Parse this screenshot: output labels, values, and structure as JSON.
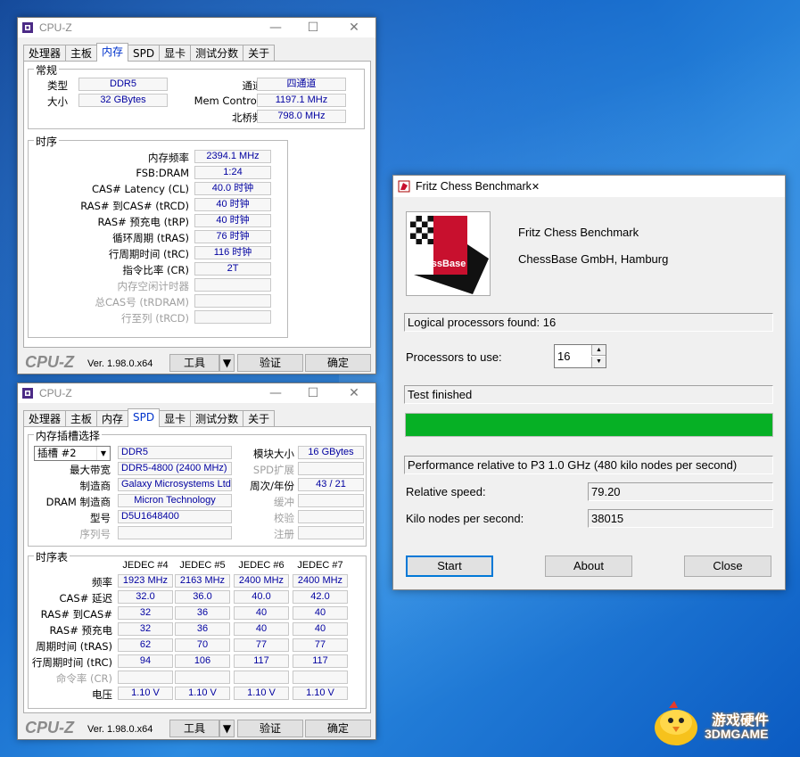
{
  "cpuz_common": {
    "title": "CPU-Z",
    "logo": "CPU-Z",
    "version": "Ver. 1.98.0.x64",
    "tools": "工具",
    "validate": "验证",
    "ok": "确定",
    "tabs": [
      "处理器",
      "主板",
      "内存",
      "SPD",
      "显卡",
      "测试分数",
      "关于"
    ]
  },
  "mem": {
    "general_title": "常规",
    "type_label": "类型",
    "type": "DDR5",
    "size_label": "大小",
    "size": "32 GBytes",
    "channels_label": "通道数",
    "channels": "四通道",
    "mc_label": "Mem Controller",
    "mc": "1197.1 MHz",
    "nb_label": "北桥频率",
    "nb": "798.0 MHz",
    "timing_title": "时序",
    "rows": [
      {
        "label": "内存频率",
        "value": "2394.1 MHz",
        "dim": false
      },
      {
        "label": "FSB:DRAM",
        "value": "1:24",
        "dim": false
      },
      {
        "label": "CAS# Latency (CL)",
        "value": "40.0 时钟",
        "dim": false
      },
      {
        "label": "RAS# 到CAS# (tRCD)",
        "value": "40 时钟",
        "dim": false
      },
      {
        "label": "RAS# 预充电 (tRP)",
        "value": "40 时钟",
        "dim": false
      },
      {
        "label": "循环周期 (tRAS)",
        "value": "76 时钟",
        "dim": false
      },
      {
        "label": "行周期时间 (tRC)",
        "value": "116 时钟",
        "dim": false
      },
      {
        "label": "指令比率 (CR)",
        "value": "2T",
        "dim": false
      },
      {
        "label": "内存空闲计时器",
        "value": "",
        "dim": true
      },
      {
        "label": "总CAS号 (tRDRAM)",
        "value": "",
        "dim": true
      },
      {
        "label": "行至列 (tRCD)",
        "value": "",
        "dim": true
      }
    ]
  },
  "spd": {
    "slot_title": "内存插槽选择",
    "slot": "插槽 #2",
    "type": "DDR5",
    "module_size_label": "模块大小",
    "module_size": "16 GBytes",
    "max_bw_label": "最大带宽",
    "max_bw": "DDR5-4800 (2400 MHz)",
    "spd_ext_label": "SPD扩展",
    "spd_ext": "",
    "mfr_label": "制造商",
    "mfr": "Galaxy Microsystems Ltd.",
    "week_label": "周次/年份",
    "week": "43 / 21",
    "dram_mfr_label": "DRAM 制造商",
    "dram_mfr": "Micron Technology",
    "buffer_label": "缓冲",
    "buffer": "",
    "part_label": "型号",
    "part": "D5U1648400",
    "check_label": "校验",
    "check": "",
    "serial_label": "序列号",
    "serial": "",
    "reg_label": "注册",
    "reg": "",
    "table_title": "时序表",
    "columns": [
      "JEDEC #4",
      "JEDEC #5",
      "JEDEC #6",
      "JEDEC #7"
    ],
    "rows": [
      {
        "label": "频率",
        "values": [
          "1923 MHz",
          "2163 MHz",
          "2400 MHz",
          "2400 MHz"
        ],
        "dim": false
      },
      {
        "label": "CAS# 延迟",
        "values": [
          "32.0",
          "36.0",
          "40.0",
          "42.0"
        ],
        "dim": false
      },
      {
        "label": "RAS# 到CAS#",
        "values": [
          "32",
          "36",
          "40",
          "40"
        ],
        "dim": false
      },
      {
        "label": "RAS# 预充电",
        "values": [
          "32",
          "36",
          "40",
          "40"
        ],
        "dim": false
      },
      {
        "label": "周期时间 (tRAS)",
        "values": [
          "62",
          "70",
          "77",
          "77"
        ],
        "dim": false
      },
      {
        "label": "行周期时间 (tRC)",
        "values": [
          "94",
          "106",
          "117",
          "117"
        ],
        "dim": false
      },
      {
        "label": "命令率 (CR)",
        "values": [
          "",
          "",
          "",
          ""
        ],
        "dim": true
      },
      {
        "label": "电压",
        "values": [
          "1.10 V",
          "1.10 V",
          "1.10 V",
          "1.10 V"
        ],
        "dim": false
      }
    ]
  },
  "fritz": {
    "title": "Fritz Chess Benchmark",
    "product": "Fritz Chess Benchmark",
    "company": "ChessBase GmbH, Hamburg",
    "logo_text": "ChessBase",
    "logical": "Logical processors found: 16",
    "proc_label": "Processors to use:",
    "proc_value": "16",
    "status": "Test finished",
    "progress": 1.0,
    "perf_label": "Performance relative to P3 1.0 GHz (480 kilo nodes per second)",
    "rel_label": "Relative speed:",
    "rel_value": "79.20",
    "kn_label": "Kilo nodes per second:",
    "kn_value": "38015",
    "start": "Start",
    "about": "About",
    "close": "Close",
    "progress_color": "#06b025"
  },
  "watermark": {
    "cn": "游戏硬件",
    "en": "3DMGAME"
  }
}
